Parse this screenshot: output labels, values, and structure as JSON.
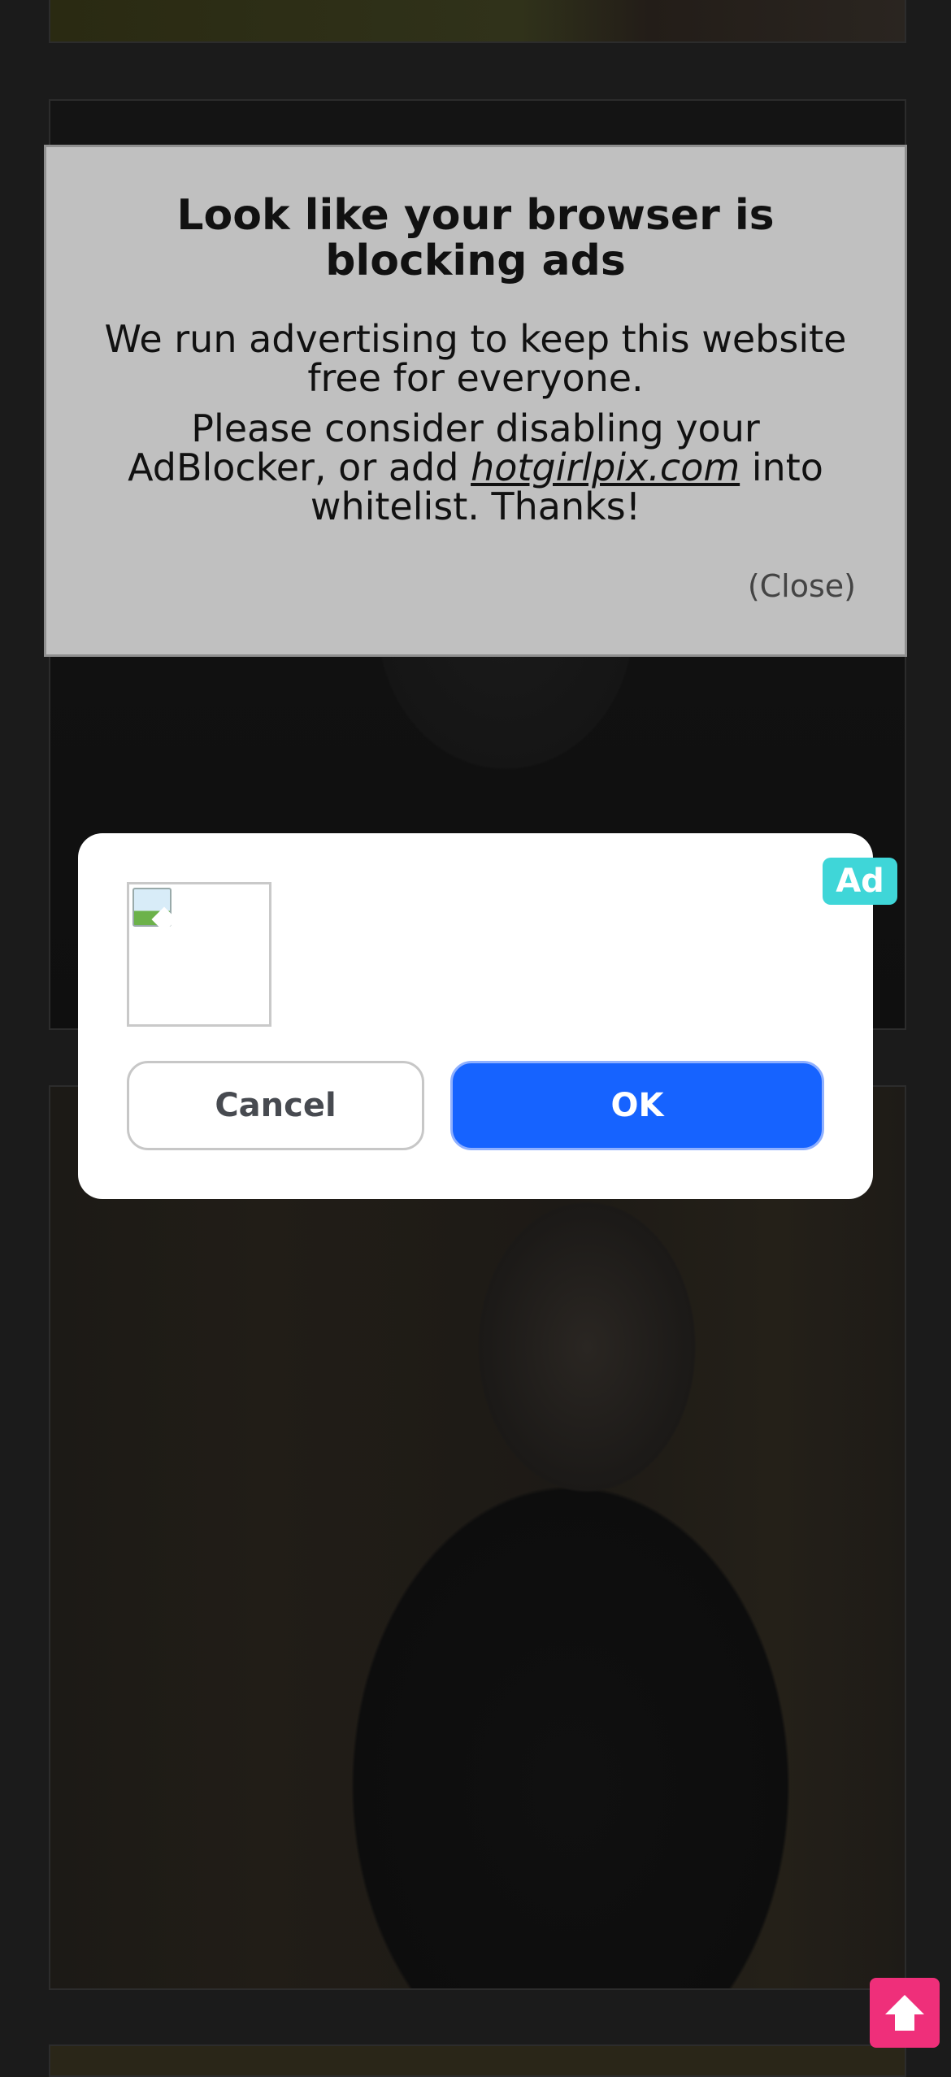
{
  "adblock_notice": {
    "heading": "Look like your browser is blocking ads",
    "message_1": "We run advertising to keep this website free for everyone.",
    "message_2_before": "Please consider disabling your AdBlocker, or add ",
    "site": "hotgirlpix.com",
    "message_2_after": " into whitelist. Thanks!",
    "close_label": "(Close)"
  },
  "ad_dialog": {
    "badge": "Ad",
    "cancel_label": "Cancel",
    "ok_label": "OK",
    "badge_color": "#3fd6d8",
    "ok_color": "#1663ff"
  },
  "scroll_top": {
    "icon": "arrow-up-icon",
    "color": "#ef2f7a"
  }
}
